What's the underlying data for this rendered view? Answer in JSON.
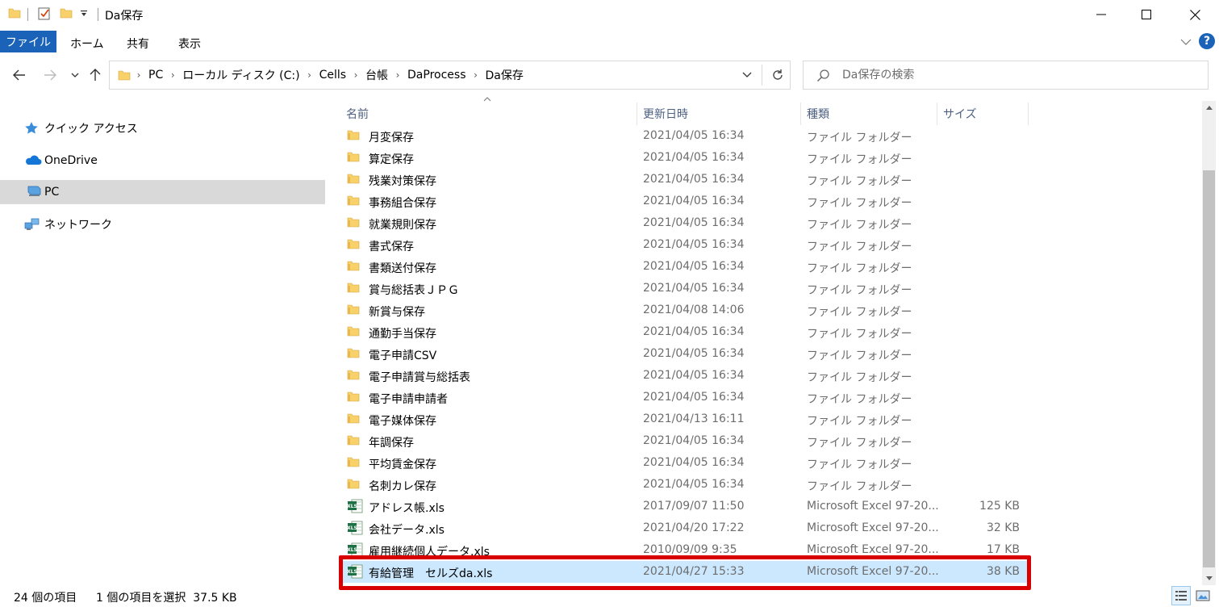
{
  "window": {
    "title": "Da保存",
    "controls": {
      "minimize": "—",
      "maximize": "☐",
      "close": "✕"
    }
  },
  "ribbon": {
    "tabs": [
      "ファイル",
      "ホーム",
      "共有",
      "表示"
    ]
  },
  "address": {
    "crumbs": [
      "PC",
      "ローカル ディスク (C:)",
      "Cells",
      "台帳",
      "DaProcess",
      "Da保存"
    ]
  },
  "search": {
    "placeholder": "Da保存の検索"
  },
  "nav": {
    "items": [
      {
        "label": "クイック アクセス",
        "icon": "star-icon"
      },
      {
        "label": "OneDrive",
        "icon": "cloud-icon"
      },
      {
        "label": "PC",
        "icon": "computer-icon"
      },
      {
        "label": "ネットワーク",
        "icon": "network-icon"
      }
    ]
  },
  "columns": {
    "name": "名前",
    "modified": "更新日時",
    "type": "種類",
    "size": "サイズ"
  },
  "files": [
    {
      "name": "月変保存",
      "date": "2021/04/05 16:34",
      "type": "ファイル フォルダー",
      "size": "",
      "icon": "folder-icon"
    },
    {
      "name": "算定保存",
      "date": "2021/04/05 16:34",
      "type": "ファイル フォルダー",
      "size": "",
      "icon": "folder-icon"
    },
    {
      "name": "残業対策保存",
      "date": "2021/04/05 16:34",
      "type": "ファイル フォルダー",
      "size": "",
      "icon": "folder-icon"
    },
    {
      "name": "事務組合保存",
      "date": "2021/04/05 16:34",
      "type": "ファイル フォルダー",
      "size": "",
      "icon": "folder-icon"
    },
    {
      "name": "就業規則保存",
      "date": "2021/04/05 16:34",
      "type": "ファイル フォルダー",
      "size": "",
      "icon": "folder-icon"
    },
    {
      "name": "書式保存",
      "date": "2021/04/05 16:34",
      "type": "ファイル フォルダー",
      "size": "",
      "icon": "folder-icon"
    },
    {
      "name": "書類送付保存",
      "date": "2021/04/05 16:34",
      "type": "ファイル フォルダー",
      "size": "",
      "icon": "folder-icon"
    },
    {
      "name": "賞与総括表ＪＰＧ",
      "date": "2021/04/05 16:34",
      "type": "ファイル フォルダー",
      "size": "",
      "icon": "folder-icon"
    },
    {
      "name": "新賞与保存",
      "date": "2021/04/08 14:06",
      "type": "ファイル フォルダー",
      "size": "",
      "icon": "folder-icon"
    },
    {
      "name": "通勤手当保存",
      "date": "2021/04/05 16:34",
      "type": "ファイル フォルダー",
      "size": "",
      "icon": "folder-icon"
    },
    {
      "name": "電子申請CSV",
      "date": "2021/04/05 16:34",
      "type": "ファイル フォルダー",
      "size": "",
      "icon": "folder-icon"
    },
    {
      "name": "電子申請賞与総括表",
      "date": "2021/04/05 16:34",
      "type": "ファイル フォルダー",
      "size": "",
      "icon": "folder-icon"
    },
    {
      "name": "電子申請申請者",
      "date": "2021/04/05 16:34",
      "type": "ファイル フォルダー",
      "size": "",
      "icon": "folder-icon"
    },
    {
      "name": "電子媒体保存",
      "date": "2021/04/13 16:11",
      "type": "ファイル フォルダー",
      "size": "",
      "icon": "folder-icon"
    },
    {
      "name": "年調保存",
      "date": "2021/04/05 16:34",
      "type": "ファイル フォルダー",
      "size": "",
      "icon": "folder-icon"
    },
    {
      "name": "平均賃金保存",
      "date": "2021/04/05 16:34",
      "type": "ファイル フォルダー",
      "size": "",
      "icon": "folder-icon"
    },
    {
      "name": "名刺カレ保存",
      "date": "2021/04/05 16:34",
      "type": "ファイル フォルダー",
      "size": "",
      "icon": "folder-icon"
    },
    {
      "name": "アドレス帳.xls",
      "date": "2017/09/07 11:50",
      "type": "Microsoft Excel 97-20...",
      "size": "125 KB",
      "icon": "excel-file-icon"
    },
    {
      "name": "会社データ.xls",
      "date": "2021/04/20 17:22",
      "type": "Microsoft Excel 97-20...",
      "size": "32 KB",
      "icon": "excel-file-icon"
    },
    {
      "name": "雇用継続個人データ.xls",
      "date": "2010/09/09 9:35",
      "type": "Microsoft Excel 97-20...",
      "size": "17 KB",
      "icon": "excel-file-icon"
    },
    {
      "name": "有給管理　セルズda.xls",
      "date": "2021/04/27 15:33",
      "type": "Microsoft Excel 97-20...",
      "size": "38 KB",
      "icon": "excel-file-icon",
      "selected": true
    }
  ],
  "status": {
    "count": "24 個の項目",
    "selection": "1 個の項目を選択  37.5 KB"
  },
  "colors": {
    "accent": "#1a63b8",
    "selection": "#cce8ff",
    "highlight_border": "#d80000",
    "folder": "#f8d16a"
  }
}
